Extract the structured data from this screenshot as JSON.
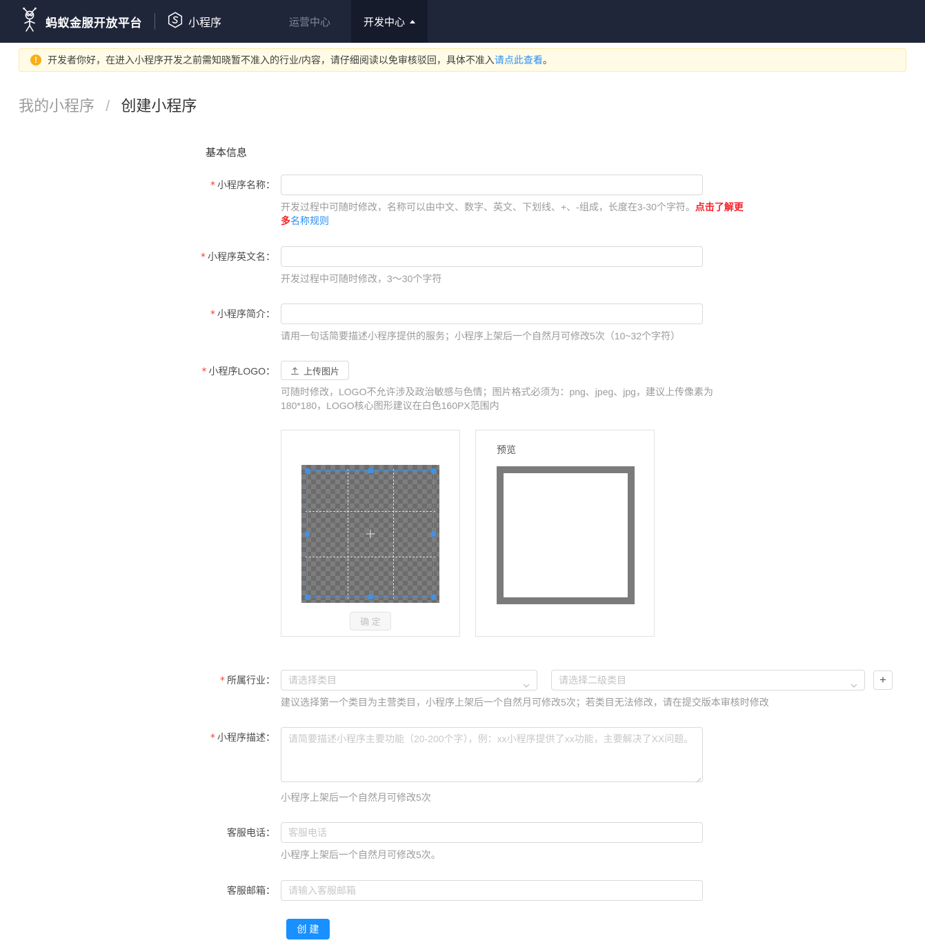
{
  "navbar": {
    "brand": "蚂蚁金服开放平台",
    "product": "小程序",
    "links": [
      {
        "label": "运营中心",
        "active": false
      },
      {
        "label": "开发中心",
        "active": true
      }
    ]
  },
  "banner": {
    "icon_glyph": "!",
    "text": "开发者你好，在进入小程序开发之前需知晓暂不准入的行业/内容，请仔细阅读以免审核驳回，具体不准入",
    "link_text": "请点此查看",
    "suffix": "。"
  },
  "breadcrumb": {
    "parent": "我的小程序",
    "separator": "/",
    "current": "创建小程序"
  },
  "form": {
    "section_title": "基本信息",
    "required_mark": "*",
    "name": {
      "label": "小程序名称：",
      "hint": "开发过程中可随时修改，名称可以由中文、数字、英文、下划线、+、-组成，长度在3-30个字符。",
      "hint_red": "点击了解更多",
      "hint_link": "名称规则"
    },
    "en_name": {
      "label": "小程序英文名：",
      "hint": "开发过程中可随时修改，3～30个字符"
    },
    "intro": {
      "label": "小程序简介：",
      "hint": "请用一句话简要描述小程序提供的服务；小程序上架后一个自然月可修改5次（10~32个字符）"
    },
    "logo": {
      "label": "小程序LOGO：",
      "upload_label": "上传图片",
      "hint": "可随时修改，LOGO不允许涉及政治敏感与色情；图片格式必须为：png、jpeg、jpg，建议上传像素为180*180，LOGO核心图形建议在白色160PX范围内",
      "confirm_label": "确 定",
      "preview_label": "预览"
    },
    "industry": {
      "label": "所属行业：",
      "select1_placeholder": "请选择类目",
      "select2_placeholder": "请选择二级类目",
      "add_label": "+",
      "hint": "建议选择第一个类目为主营类目，小程序上架后一个自然月可修改5次；若类目无法修改，请在提交版本审核时修改"
    },
    "description": {
      "label": "小程序描述：",
      "placeholder": "请简要描述小程序主要功能（20-200个字），例：xx小程序提供了xx功能，主要解决了XX问题。",
      "hint": "小程序上架后一个自然月可修改5次"
    },
    "phone": {
      "label": "客服电话：",
      "placeholder": "客服电话",
      "hint": "小程序上架后一个自然月可修改5次。"
    },
    "email": {
      "label": "客服邮箱：",
      "placeholder": "请输入客服邮箱"
    },
    "submit_label": "创 建"
  },
  "colors": {
    "navbar_bg": "#20263a",
    "active_tab_bg": "#161b2c",
    "banner_bg": "#fffbe6",
    "banner_border": "#ffe9a8",
    "warning_icon": "#faad14",
    "link_blue": "#2b8ff7",
    "warn_red": "#f5222d",
    "required_red": "#f04134",
    "accent_blue": "#1890ff",
    "crop_blue": "#4191e9",
    "preview_frame_gray": "#7b7b7b"
  },
  "icons": {
    "ant_logo": "ant-figure",
    "miniprogram": "hexagon-s",
    "warning": "exclamation-circle",
    "upload": "arrow-up-tray",
    "chevron": "chevron-down",
    "caret": "caret-up"
  }
}
